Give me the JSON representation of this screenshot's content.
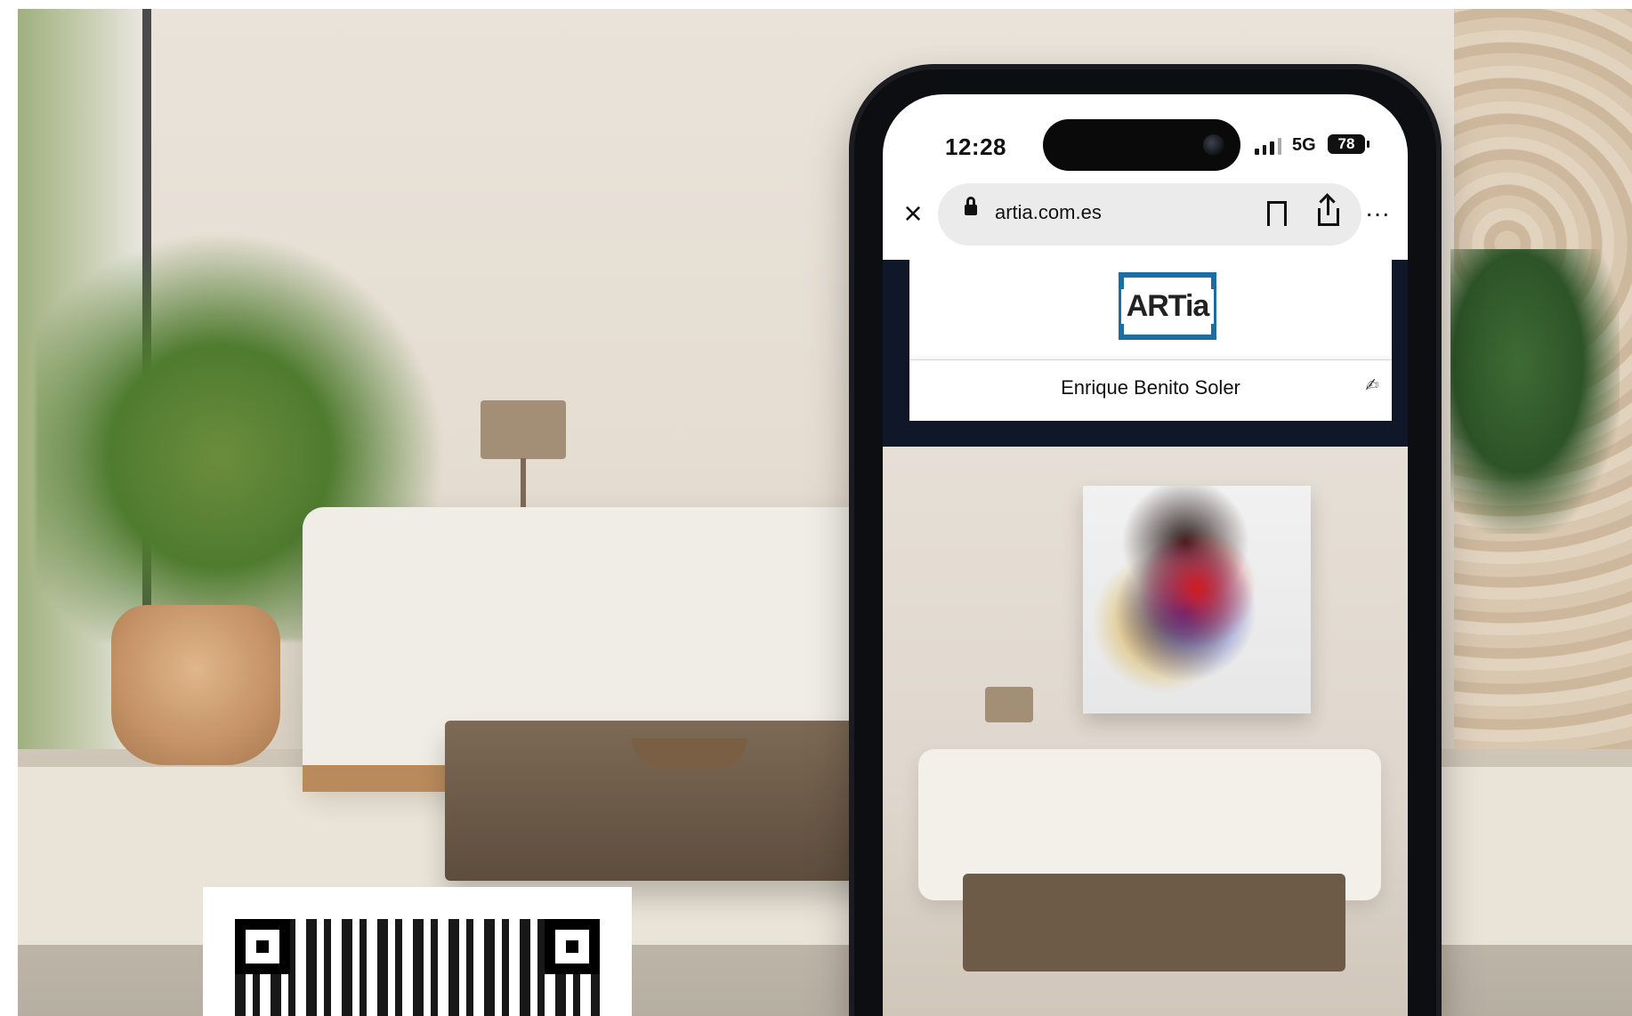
{
  "colors": {
    "phone_body": "#0d0e12",
    "url_pill": "#ebebeb",
    "brand_band": "#0f1728",
    "logo_border": "#1c6da3"
  },
  "status_bar": {
    "time": "12:28",
    "network": "5G",
    "battery": "78"
  },
  "browser": {
    "close_icon": "close-icon",
    "lock_icon": "lock-icon",
    "url": "artia.com.es",
    "bookmark_icon": "bookmark-icon",
    "share_icon": "share-icon",
    "more_icon": "more-icon",
    "more_label": "···"
  },
  "site": {
    "logo_text": "ARTia",
    "artist_name": "Enrique Benito Soler"
  }
}
